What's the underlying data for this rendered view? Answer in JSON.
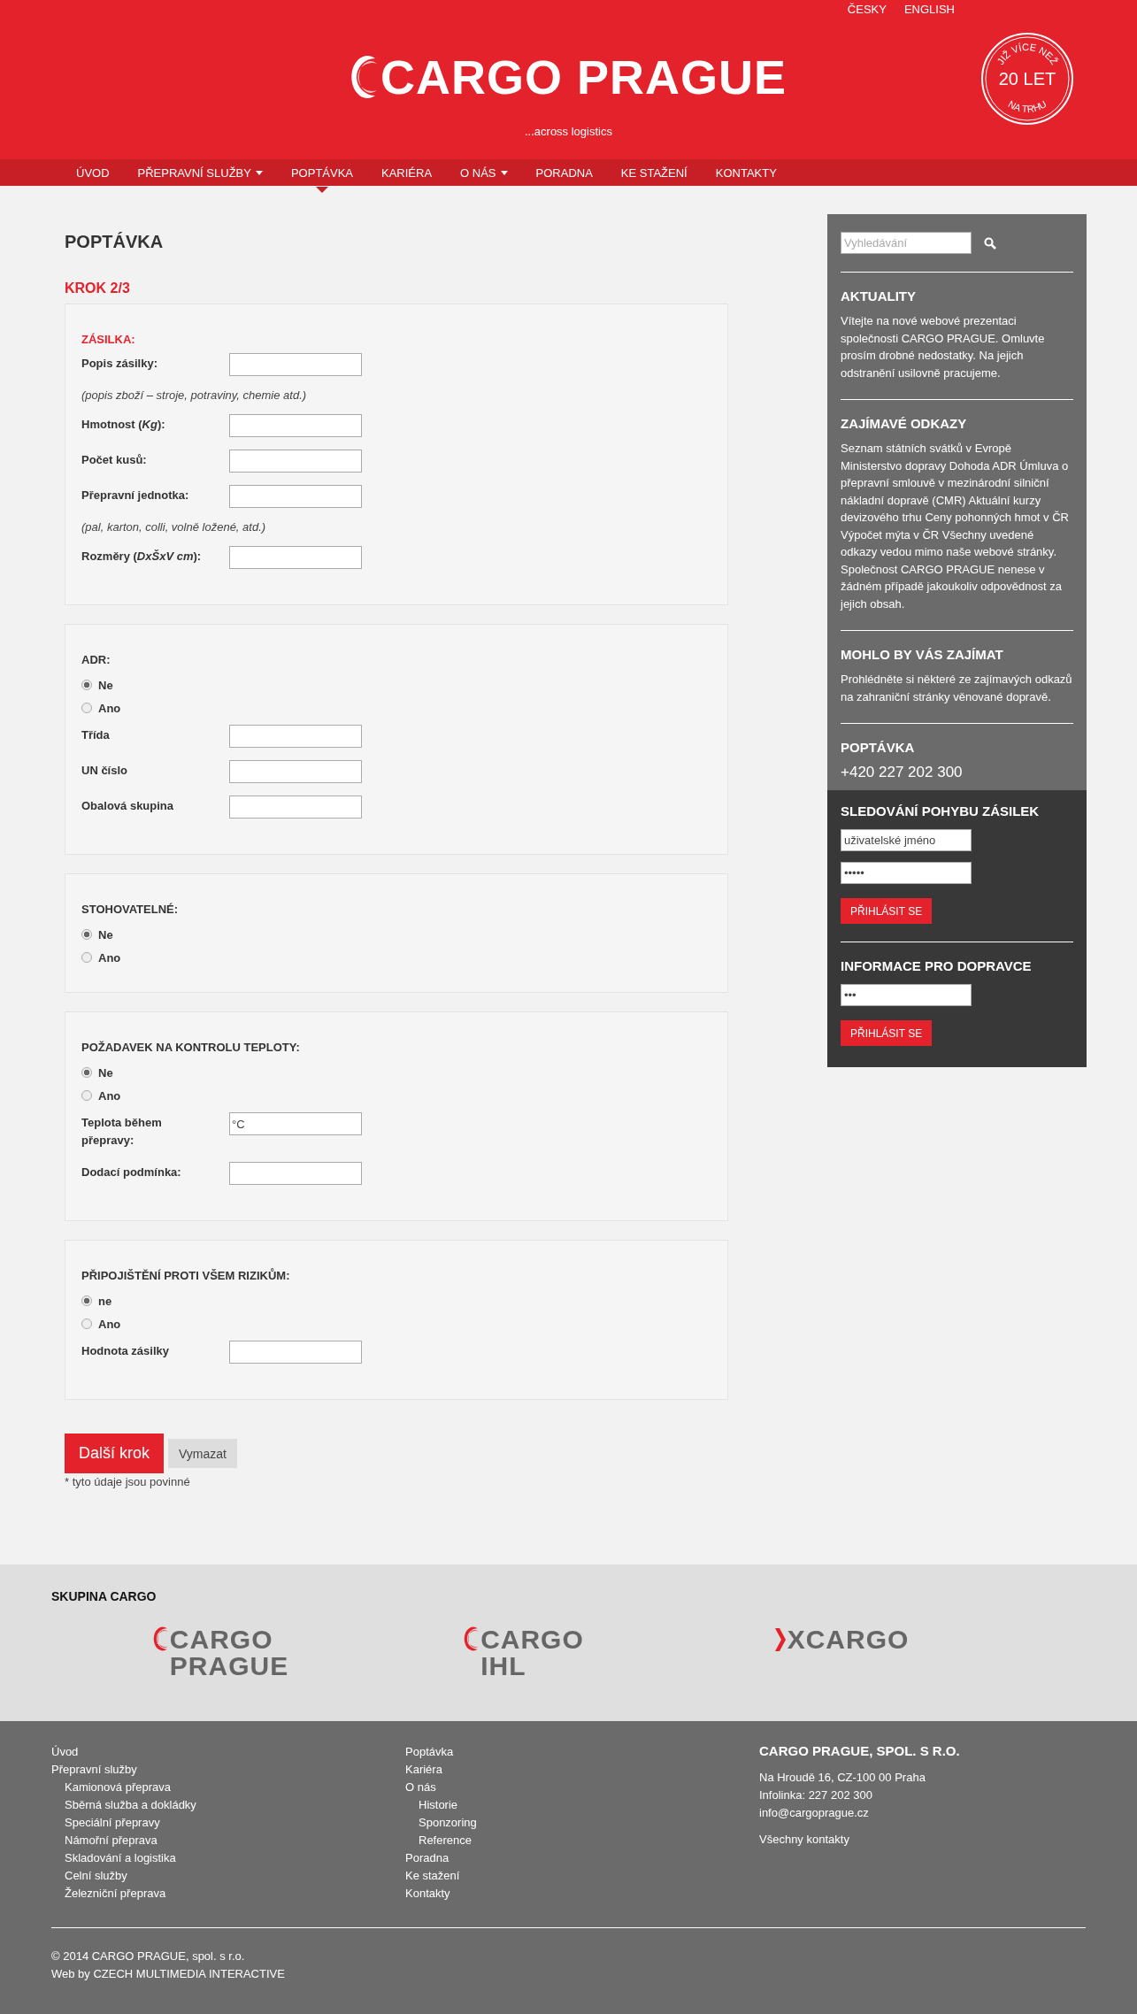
{
  "languages": [
    {
      "label": "ČESKY"
    },
    {
      "label": "ENGLISH"
    }
  ],
  "logo": {
    "text": "CARGO PRAGUE",
    "tagline": "...across logistics"
  },
  "badge": {
    "top": "JIŽ VÍCE NEŽ",
    "middle": "20 LET",
    "bottom": "NA TRHU"
  },
  "nav": [
    {
      "label": "ÚVOD",
      "selected": false,
      "has_menu": false
    },
    {
      "label": "PŘEPRAVNÍ SLUŽBY",
      "selected": false,
      "has_menu": true
    },
    {
      "label": "POPTÁVKA",
      "selected": true,
      "has_menu": false
    },
    {
      "label": "KARIÉRA",
      "selected": false,
      "has_menu": false
    },
    {
      "label": "O NÁS",
      "selected": false,
      "has_menu": true
    },
    {
      "label": "PORADNA",
      "selected": false,
      "has_menu": false
    },
    {
      "label": "KE STAŽENÍ",
      "selected": false,
      "has_menu": false
    },
    {
      "label": "KONTAKTY",
      "selected": false,
      "has_menu": false
    }
  ],
  "page_title": "POPTÁVKA",
  "step": "KROK 2/3",
  "sections": [
    {
      "title": "ZÁSILKA:",
      "kind": "accent",
      "items": [
        {
          "kind": "field",
          "label": "Popis zásilky:"
        },
        {
          "kind": "hint",
          "label": "(popis zboží – stroje, potraviny, chemie atd.)"
        },
        {
          "kind": "field",
          "label": "Hmotnost (*Kg*):"
        },
        {
          "kind": "field",
          "label": "Počet kusů:"
        },
        {
          "kind": "field",
          "label": "Přepravní jednotka:"
        },
        {
          "kind": "hint",
          "label": "(pal, karton, colli, volně ložené, atd.)"
        },
        {
          "kind": "field",
          "label": "Rozměry (*DxŠxV cm*):"
        }
      ]
    },
    {
      "title": "ADR:",
      "kind": "plain",
      "items": [
        {
          "kind": "radio",
          "label": "Ne",
          "selected": true
        },
        {
          "kind": "radio",
          "label": "Ano",
          "selected": false
        },
        {
          "kind": "field",
          "label": "Třída"
        },
        {
          "kind": "field",
          "label": "UN číslo"
        },
        {
          "kind": "field",
          "label": "Obalová skupina"
        }
      ]
    },
    {
      "title": "STOHOVATELNÉ:",
      "kind": "plain",
      "items": [
        {
          "kind": "radio",
          "label": "Ne",
          "selected": true
        },
        {
          "kind": "radio",
          "label": "Ano",
          "selected": false
        }
      ]
    },
    {
      "title": "POŽADAVEK NA KONTROLU TEPLOTY:",
      "kind": "plain",
      "items": [
        {
          "kind": "radio",
          "label": "Ne",
          "selected": true
        },
        {
          "kind": "radio",
          "label": "Ano",
          "selected": false
        },
        {
          "kind": "field",
          "label": "Teplota během přepravy:",
          "value": "°C"
        },
        {
          "kind": "field",
          "label": "Dodací podmínka:"
        }
      ]
    },
    {
      "title": "PŘIPOJIŠTĚNÍ PROTI VŠEM RIZIKŮM:",
      "kind": "plain",
      "items": [
        {
          "kind": "radio",
          "label": "ne",
          "selected": true
        },
        {
          "kind": "radio",
          "label": "Ano",
          "selected": false
        },
        {
          "kind": "field",
          "label": "Hodnota zásilky"
        }
      ]
    }
  ],
  "buttons": {
    "next": "Další krok",
    "clear": "Vymazat"
  },
  "required_note": "* tyto údaje jsou povinné",
  "sidebar": {
    "search": {
      "placeholder": "Vyhledávání"
    },
    "blocks": [
      {
        "title": "AKTUALITY",
        "text": "Vítejte na nové webové prezentaci společnosti CARGO PRAGUE. Omluvte prosím drobné nedostatky. Na jejich odstranění usilovně pracujeme."
      },
      {
        "title": "ZAJÍMAVÉ ODKAZY",
        "text": "Seznam státních svátků v Evropě Ministerstvo dopravy Dohoda ADR Úmluva o přepravní smlouvě v mezinárodní silniční nákladní dopravě (CMR) Aktuální kurzy devizového trhu Ceny pohonných hmot v ČR Výpočet mýta v ČR Všechny uvedené odkazy vedou mimo naše webové stránky. Společnost CARGO PRAGUE nenese v žádném případě jakoukoliv odpovědnost za jejich obsah."
      },
      {
        "title": "MOHLO BY VÁS ZAJÍMAT",
        "text": "Prohlédněte si některé ze zajímavých odkazů na zahraniční stránky věnované dopravě."
      }
    ],
    "contact": {
      "title": "POPTÁVKA",
      "phone": "+420 227 202 300"
    },
    "logins": [
      {
        "title": "SLEDOVÁNÍ POHYBU ZÁSILEK",
        "fields": [
          {
            "value": "uživatelské jméno"
          },
          {
            "value": "•••••"
          }
        ],
        "button": "PŘIHLÁSIT SE"
      },
      {
        "title": "INFORMACE PRO DOPRAVCE",
        "fields": [
          {
            "value": "•••"
          }
        ],
        "button": "PŘIHLÁSIT SE"
      }
    ]
  },
  "group": {
    "title": "SKUPINA CARGO",
    "logos": [
      {
        "kind": "swoosh",
        "lines": [
          "CARGO",
          "PRAGUE"
        ]
      },
      {
        "kind": "swoosh",
        "lines": [
          "CARGO",
          "IHL"
        ]
      },
      {
        "kind": "chevron",
        "lines": [
          "XCARGO"
        ]
      }
    ]
  },
  "footer": {
    "columns": [
      {
        "links": [
          {
            "label": "Úvod"
          },
          {
            "label": "Přepravní služby",
            "children": [
              {
                "label": "Kamionová přeprava"
              },
              {
                "label": "Sběrná služba a dokládky"
              },
              {
                "label": "Speciální přepravy"
              },
              {
                "label": "Námořní přeprava"
              },
              {
                "label": "Skladování a logistika"
              },
              {
                "label": "Celní služby"
              },
              {
                "label": "Železniční přeprava"
              }
            ]
          }
        ]
      },
      {
        "links": [
          {
            "label": "Poptávka"
          },
          {
            "label": "Kariéra"
          },
          {
            "label": "O nás",
            "children": [
              {
                "label": "Historie"
              },
              {
                "label": "Sponzoring"
              },
              {
                "label": "Reference"
              }
            ]
          },
          {
            "label": "Poradna"
          },
          {
            "label": "Ke stažení"
          },
          {
            "label": "Kontakty"
          }
        ]
      }
    ],
    "company": {
      "name": "CARGO PRAGUE, SPOL. S R.O.",
      "lines": [
        "Na Hroudě 16, CZ-100 00 Praha",
        "Infolinka: 227 202 300",
        "info@cargoprague.cz"
      ],
      "link": "Všechny kontakty"
    },
    "copyright": "© 2014 CARGO PRAGUE, spol. s r.o.",
    "credit": "Web by CZECH MULTIMEDIA INTERACTIVE"
  }
}
